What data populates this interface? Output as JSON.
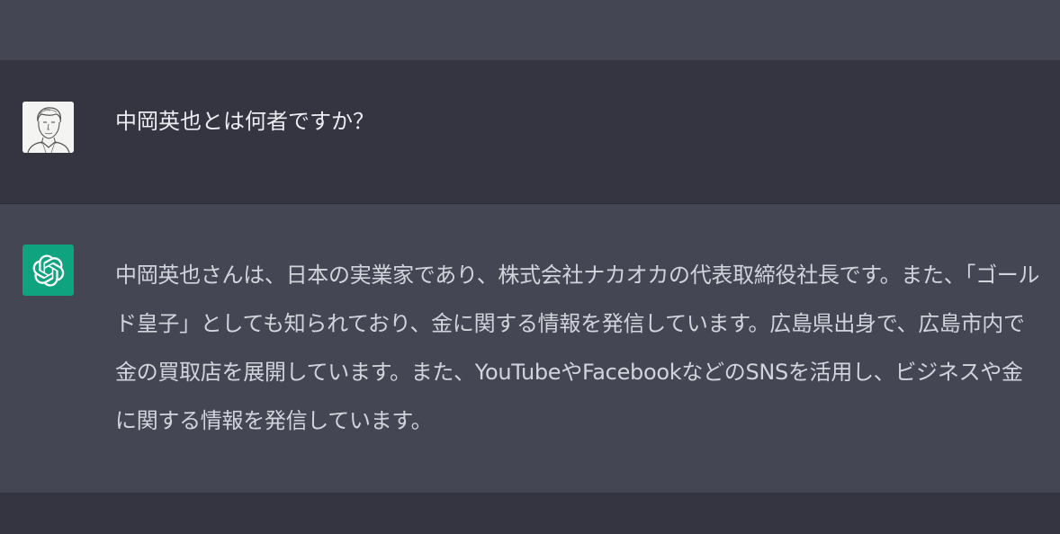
{
  "conversation": {
    "user_message": {
      "avatar_icon": "user-sketch-portrait-icon",
      "text": "中岡英也とは何者ですか？"
    },
    "assistant_message": {
      "avatar_icon": "openai-logo-icon",
      "avatar_color": "#10a37f",
      "text": "中岡英也さんは、日本の実業家であり、株式会社ナカオカの代表取締役社長です。また、「ゴールド皇子」としても知られており、金に関する情報を発信しています。広島県出身で、広島市内で金の買取店を展開しています。また、YouTubeやFacebookなどのSNSを活用し、ビジネスや金に関する情報を発信しています。"
    }
  },
  "colors": {
    "assistant_background": "#444654",
    "user_background": "#343541",
    "user_text": "#ececf1",
    "assistant_text": "#d1d5db"
  }
}
